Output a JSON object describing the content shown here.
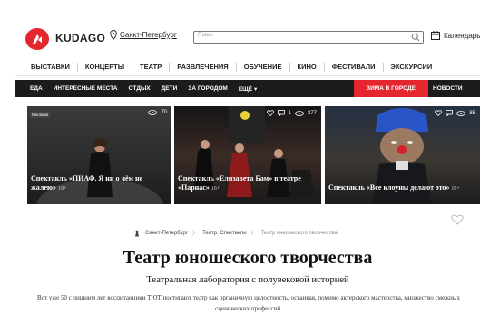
{
  "header": {
    "logo": "KUDAGO",
    "city": "Санкт-Петербург",
    "search_placeholder": "Поиск",
    "calendar_label": "Календарь"
  },
  "categories": [
    "ВЫСТАВКИ",
    "КОНЦЕРТЫ",
    "ТЕАТР",
    "РАЗВЛЕЧЕНИЯ",
    "ОБУЧЕНИЕ",
    "КИНО",
    "ФЕСТИВАЛИ",
    "ЭКСКУРСИИ"
  ],
  "submenu": {
    "items": [
      "ЕДА",
      "ИНТЕРЕСНЫЕ МЕСТА",
      "ОТДЫХ",
      "ДЕТИ",
      "ЗА ГОРОДОМ",
      "ЕЩЁ ▾"
    ],
    "highlight": "ЗИМА В ГОРОДЕ",
    "news": "НОВОСТИ"
  },
  "cards": [
    {
      "tag": "Реклама",
      "title": "Спектакль «ПИАФ. Я ни о чём не жалею»",
      "age": "18+",
      "views": "70"
    },
    {
      "title": "Спектакль «Елизавета Бам» в театре «Парнас»",
      "age": "16+",
      "comments": "1",
      "views": "377"
    },
    {
      "title": "Спектакль «Все клоуны делают это»",
      "age": "18+",
      "views": "85"
    }
  ],
  "breadcrumb": {
    "items": [
      "Санкт-Петербург",
      "Театр. Спектакли",
      "Театр юношеского творчества"
    ]
  },
  "page": {
    "title": "Театр юношеского творчества",
    "subtitle": "Театральная лаборатория с полувековой историей",
    "description": "Вот уже 50 с лишним лет воспитанники ТЮТ постигают театр как органичную целостность, осваивая, помимо актерского мастерства, множество смежных сценических профессий."
  },
  "colors": {
    "brand_red": "#e4262f",
    "submenu_bg": "#1c1c1c"
  },
  "icons": [
    "logo-mark-icon",
    "location-pin-icon",
    "search-icon",
    "calendar-icon",
    "eye-icon",
    "heart-icon",
    "comment-icon",
    "home-icon"
  ]
}
